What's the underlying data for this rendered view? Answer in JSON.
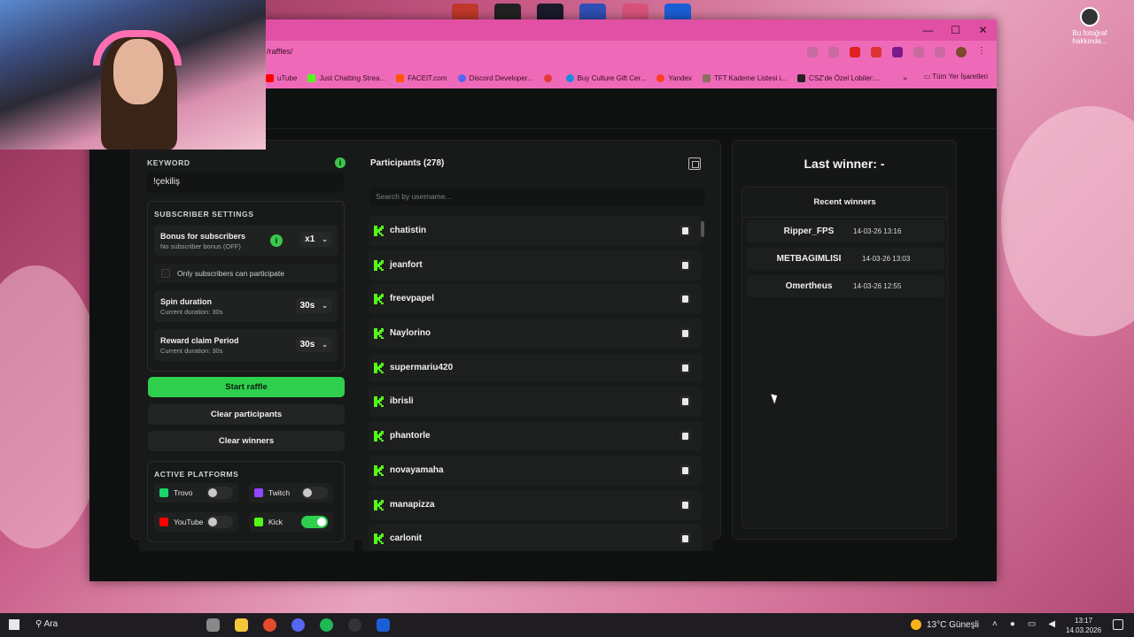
{
  "desktop": {
    "top_right_icon_label": "Bu fotoğraf hakkında..."
  },
  "browser": {
    "url": "/raffles/",
    "bookmarks": [
      {
        "label": "uTube",
        "color": "#ff0000"
      },
      {
        "label": "Just Chatting Strea...",
        "color": "#53fc18"
      },
      {
        "label": "FACEIT.com",
        "color": "#ff5500"
      },
      {
        "label": "Discord Developer...",
        "color": "#5865f2"
      },
      {
        "label": "",
        "color": "#e53935"
      },
      {
        "label": "Buy Culture Gift Cer...",
        "color": "#1e88e5"
      },
      {
        "label": "Yandex",
        "color": "#fc3f1d"
      },
      {
        "label": "TFT Kademe Listesi i...",
        "color": "#8d6e63"
      },
      {
        "label": "CSZ'de Özel Lobiler:...",
        "color": "#222222"
      }
    ],
    "bookmarks_overflow": "»",
    "all_bookmarks": "Tüm Yer İşaretleri",
    "window_controls": [
      "—",
      "☐",
      "✕"
    ]
  },
  "settings": {
    "keyword_label": "KEYWORD",
    "info_glyph": "i",
    "keyword_value": "!çekiliş",
    "subscriber_title": "SUBSCRIBER SETTINGS",
    "bonus": {
      "title": "Bonus for subscribers",
      "subtitle": "No subscriber bonus (OFF)",
      "value": "x1"
    },
    "only_subs_label": "Only subscribers can participate",
    "spin": {
      "title": "Spin duration",
      "subtitle": "Current duration: 30s",
      "value": "30s"
    },
    "reward": {
      "title": "Reward claim Period",
      "subtitle": "Current duration: 30s",
      "value": "30s"
    },
    "start_button": "Start raffle",
    "clear_participants_button": "Clear participants",
    "clear_winners_button": "Clear winners",
    "platforms_title": "ACTIVE PLATFORMS",
    "platforms": [
      {
        "name": "Trovo",
        "color": "#19d66b",
        "enabled": false
      },
      {
        "name": "Twitch",
        "color": "#9146ff",
        "enabled": false
      },
      {
        "name": "YouTube",
        "color": "#ff0000",
        "enabled": false
      },
      {
        "name": "Kick",
        "color": "#53fc18",
        "enabled": true
      }
    ]
  },
  "participants": {
    "title": "Participants (278)",
    "search_placeholder": "Search by username...",
    "list": [
      "chatistin",
      "jeanfort",
      "freevpapel",
      "Naylorino",
      "supermariu420",
      "ibrisli",
      "phantorle",
      "novayamaha",
      "manapizza",
      "carlonit"
    ]
  },
  "winners": {
    "last_winner": "Last winner: -",
    "recent_title": "Recent winners",
    "recent": [
      {
        "name": "Ripper_FPS",
        "date": "14-03-26 13:16"
      },
      {
        "name": "METBAGIMLISI",
        "date": "14-03-26 13:03"
      },
      {
        "name": "Omertheus",
        "date": "14-03-26 12:55"
      }
    ]
  },
  "taskbar": {
    "search": "Ara",
    "weather": "13°C  Güneşli",
    "time": "13:17",
    "date": "14.03.2026"
  },
  "colors": {
    "accent_green": "#2fcf4e",
    "browser_pink": "#e150a4"
  }
}
